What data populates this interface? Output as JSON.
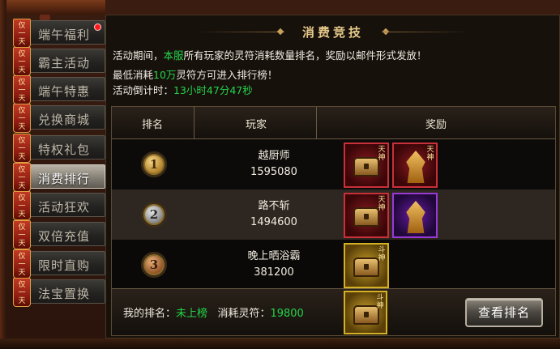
{
  "sidebar": {
    "items": [
      {
        "tag": [
          "仅",
          "一",
          "天"
        ],
        "label": "端午福利",
        "active": false,
        "badge": true
      },
      {
        "tag": [
          "仅",
          "一",
          "天"
        ],
        "label": "霸主活动",
        "active": false,
        "badge": false
      },
      {
        "tag": [
          "仅",
          "一",
          "天"
        ],
        "label": "端午特惠",
        "active": false,
        "badge": false
      },
      {
        "tag": [
          "仅",
          "一",
          "天"
        ],
        "label": "兑换商城",
        "active": false,
        "badge": false
      },
      {
        "tag": [
          "仅",
          "一",
          "天"
        ],
        "label": "特权礼包",
        "active": false,
        "badge": false
      },
      {
        "tag": [
          "仅",
          "一",
          "天"
        ],
        "label": "消费排行",
        "active": true,
        "badge": false
      },
      {
        "tag": [
          "仅",
          "一",
          "天"
        ],
        "label": "活动狂欢",
        "active": false,
        "badge": false
      },
      {
        "tag": [
          "仅",
          "一",
          "天"
        ],
        "label": "双倍充值",
        "active": false,
        "badge": false
      },
      {
        "tag": [
          "仅",
          "一",
          "天"
        ],
        "label": "限时直购",
        "active": false,
        "badge": false
      },
      {
        "tag": [
          "仅",
          "一",
          "天"
        ],
        "label": "法宝置换",
        "active": false,
        "badge": false
      }
    ]
  },
  "main": {
    "title": "消费竞技",
    "line1": {
      "a": "活动期间，",
      "b": "本服",
      "c": "所有玩家的灵符消耗数量排名，奖励以邮件形式发放！"
    },
    "line2": {
      "a": "最低消耗",
      "b": "10万",
      "c": "灵符方可进入排行榜！"
    },
    "line3": {
      "a": "活动倒计时：",
      "b": "13小时47分47秒"
    },
    "headers": {
      "rank": "排名",
      "player": "玩家",
      "reward": "奖励"
    },
    "rows": [
      {
        "rank": "1",
        "name": "越厨师",
        "value": "1595080"
      },
      {
        "rank": "2",
        "name": "路不斩",
        "value": "1494600"
      },
      {
        "rank": "3",
        "name": "晚上晒浴霸",
        "value": "381200"
      }
    ],
    "reward_tags": {
      "tian": [
        "天",
        "神"
      ],
      "dou": [
        "斗",
        "神"
      ]
    },
    "footer": {
      "my_rank_label": "我的排名：",
      "my_rank_value": "未上榜",
      "consume_label": "消耗灵符：",
      "consume_value": "19800",
      "button": "查看排名"
    }
  },
  "colors": {
    "green": "#24d44a",
    "yellow": "#e8d23a",
    "badge_red": "#ff1a1a"
  }
}
